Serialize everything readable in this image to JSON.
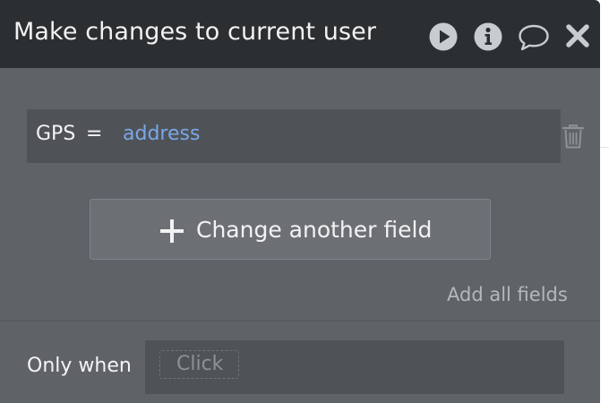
{
  "header": {
    "title": "Make changes to current user",
    "icons": [
      "play-icon",
      "info-icon",
      "comment-icon",
      "close-icon"
    ]
  },
  "field": {
    "name": "GPS",
    "operator": "=",
    "value": "address"
  },
  "actions": {
    "change_another_field_label": "Change another field",
    "add_all_fields_label": "Add all fields"
  },
  "condition": {
    "label": "Only when",
    "placeholder": "Click"
  },
  "colors": {
    "header_bg": "#2b2f32",
    "panel_bg": "#5f6368",
    "field_bg": "#4f5357",
    "dynamic_value": "#7aa7e8"
  }
}
